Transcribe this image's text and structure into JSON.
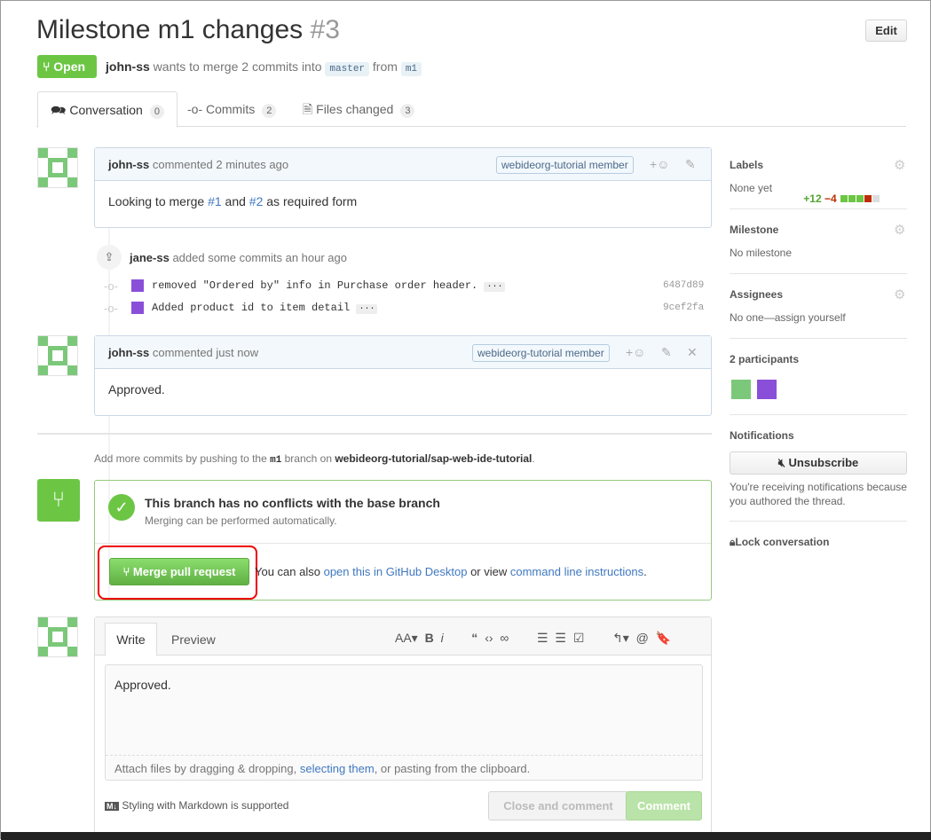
{
  "header": {
    "title": "Milestone m1 changes",
    "number": "#3",
    "edit": "Edit",
    "state": "Open",
    "author": "john-ss",
    "meta_text": "wants to merge 2 commits into",
    "base": "master",
    "from": "from",
    "head": "m1"
  },
  "tabs": [
    {
      "label": "Conversation",
      "count": "0"
    },
    {
      "label": "Commits",
      "count": "2"
    },
    {
      "label": "Files changed",
      "count": "3"
    }
  ],
  "diffstat": {
    "additions": "+12",
    "deletions": "−4"
  },
  "comments": [
    {
      "author": "john-ss",
      "action": "commented 2 minutes ago",
      "badge": "webideorg-tutorial member",
      "body_pre": "Looking to merge ",
      "ref1": "#1",
      "and": " and ",
      "ref2": "#2",
      "body_post": " as required form"
    },
    {
      "author": "john-ss",
      "action": "commented just now",
      "badge": "webideorg-tutorial member",
      "body": "Approved."
    }
  ],
  "commit_event": {
    "author": "jane-ss",
    "text": "added some commits an hour ago",
    "commits": [
      {
        "message": "removed \"Ordered by\" info in Purchase order header.",
        "sha": "6487d89"
      },
      {
        "message": "Added product id to item detail",
        "sha": "9cef2fa"
      }
    ]
  },
  "push_hint": {
    "pre": "Add more commits by pushing to the ",
    "branch": "m1",
    "mid": " branch on ",
    "repo": "webideorg-tutorial/sap-web-ide-tutorial",
    "post": "."
  },
  "merge": {
    "title": "This branch has no conflicts with the base branch",
    "subtitle": "Merging can be performed automatically.",
    "button": "Merge pull request",
    "alt_pre": "You can also ",
    "alt_link1": "open this in GitHub Desktop",
    "alt_mid": " or view ",
    "alt_link2": "command line instructions",
    "alt_post": "."
  },
  "editor": {
    "tab_write": "Write",
    "tab_preview": "Preview",
    "value": "Approved.",
    "attach_pre": "Attach files by dragging & dropping, ",
    "attach_link": "selecting them",
    "attach_post": ", or pasting from the clipboard.",
    "markdown": "Styling with Markdown is supported",
    "close_btn": "Close and comment",
    "comment_btn": "Comment"
  },
  "sidebar": {
    "labels_h": "Labels",
    "labels_v": "None yet",
    "milestone_h": "Milestone",
    "milestone_v": "No milestone",
    "assignees_h": "Assignees",
    "assignees_v": "No one—assign yourself",
    "participants_h": "2 participants",
    "notifications_h": "Notifications",
    "unsubscribe": "Unsubscribe",
    "notif_text": "You're receiving notifications because you authored the thread.",
    "lock": "Lock conversation"
  },
  "colors": {
    "open": "#6cc644",
    "merge": "#55a532",
    "link": "#4078c0"
  }
}
